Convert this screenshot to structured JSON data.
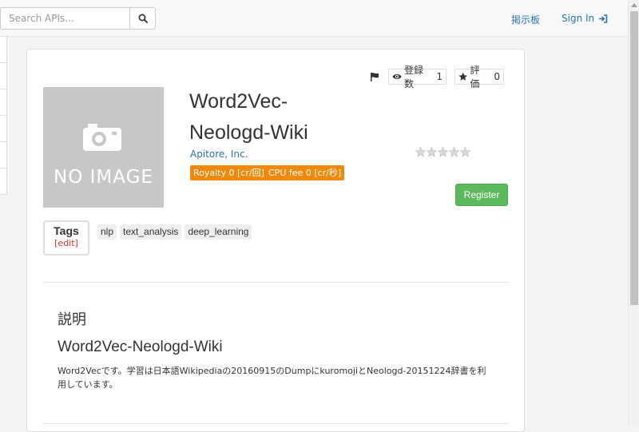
{
  "navbar": {
    "search_placeholder": "Search APIs...",
    "board_label": "掲示板",
    "signin_label": "Sign In"
  },
  "api": {
    "title": "Word2Vec-Neologd-Wiki",
    "image_text": "NO IMAGE",
    "provider": "Apitore, Inc.",
    "royalty": "Royalty 0 [cr/回]",
    "cpu_fee": "CPU fee 0 [cr/秒]",
    "register_label": "Register",
    "registrations_label": "登録数",
    "registrations_count": "1",
    "rating_label": "評価",
    "rating_count": "0",
    "rating_stars": 0
  },
  "tags": {
    "title": "Tags",
    "edit_label": "[edit]",
    "items": [
      "nlp",
      "text_analysis",
      "deep_learning"
    ]
  },
  "description": {
    "heading": "説明",
    "title": "Word2Vec-Neologd-Wiki",
    "body": "Word2Vecです。学習は日本語Wikipediaの20160915のDumpにkuromojiとNeologd-20151224辞書を利用しています。"
  },
  "colors": {
    "link": "#2a73b8",
    "fee_badge": "#f0890a",
    "register_button": "#5cb85c",
    "tag_edit": "#d9302c"
  }
}
